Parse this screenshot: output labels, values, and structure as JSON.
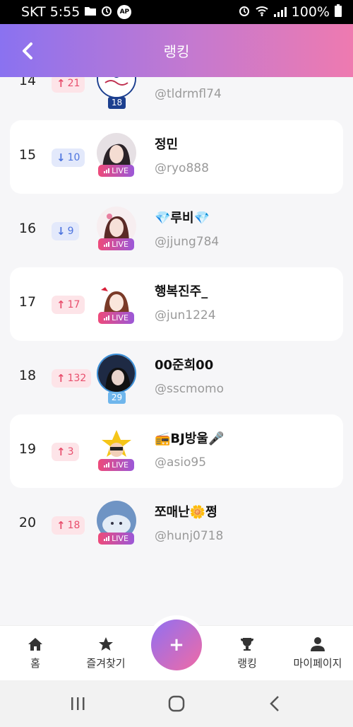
{
  "status": {
    "carrier_time": "SKT 5:55",
    "battery": "100%",
    "ap_badge": "AP"
  },
  "header": {
    "title": "랭킹",
    "back": "back"
  },
  "colors": {
    "up": "#e84f6d",
    "down": "#4d74de",
    "live_start": "#ee4a7a",
    "live_end": "#9b58d8"
  },
  "ranking": [
    {
      "rank": "14",
      "change": "21",
      "dir": "up",
      "name": "",
      "handle": "@tldrmfl74",
      "badge": "18",
      "badge_type": "level"
    },
    {
      "rank": "15",
      "change": "10",
      "dir": "down",
      "name": "정민",
      "handle": "@ryo888",
      "badge": "LIVE",
      "badge_type": "live"
    },
    {
      "rank": "16",
      "change": "9",
      "dir": "down",
      "name": "💎루비💎",
      "handle": "@jjung784",
      "badge": "LIVE",
      "badge_type": "live"
    },
    {
      "rank": "17",
      "change": "17",
      "dir": "up",
      "name": "행복진주_",
      "handle": "@jun1224",
      "badge": "LIVE",
      "badge_type": "live"
    },
    {
      "rank": "18",
      "change": "132",
      "dir": "up",
      "name": "00준희00",
      "handle": "@sscmomo",
      "badge": "29",
      "badge_type": "level"
    },
    {
      "rank": "19",
      "change": "3",
      "dir": "up",
      "name": "📻BJ방울🎤",
      "handle": "@asio95",
      "badge": "LIVE",
      "badge_type": "live"
    },
    {
      "rank": "20",
      "change": "18",
      "dir": "up",
      "name": "쪼매난🌼쩡",
      "handle": "@hunj0718",
      "badge": "LIVE",
      "badge_type": "live"
    }
  ],
  "nav": {
    "home": "홈",
    "favorites": "즐겨찾기",
    "fab": "+",
    "ranking": "랭킹",
    "mypage": "마이페이지"
  }
}
